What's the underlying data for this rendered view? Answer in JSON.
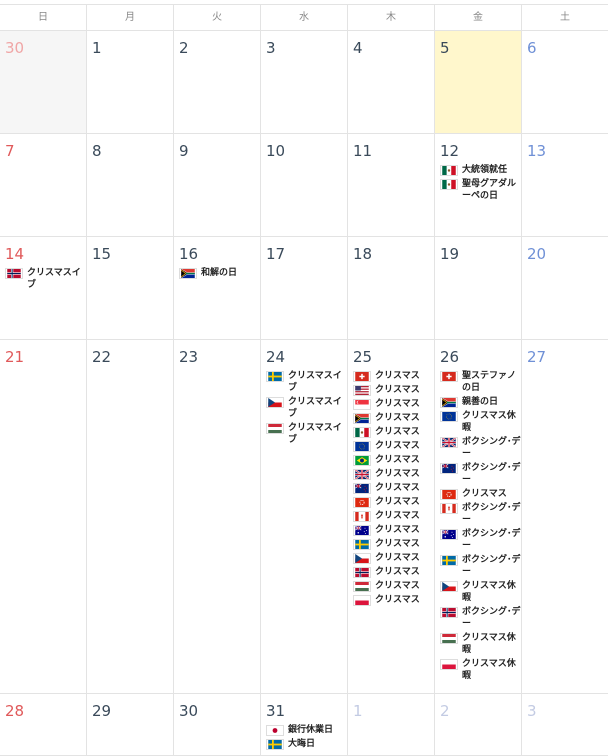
{
  "weekdays": [
    "日",
    "月",
    "火",
    "水",
    "木",
    "金",
    "土"
  ],
  "weeks": [
    {
      "days": [
        {
          "num": "30",
          "kind": "outside-sun",
          "events": []
        },
        {
          "num": "1",
          "kind": "normal",
          "events": []
        },
        {
          "num": "2",
          "kind": "normal",
          "events": []
        },
        {
          "num": "3",
          "kind": "normal",
          "events": []
        },
        {
          "num": "4",
          "kind": "normal",
          "events": []
        },
        {
          "num": "5",
          "kind": "today",
          "events": []
        },
        {
          "num": "6",
          "kind": "sat",
          "events": []
        }
      ]
    },
    {
      "days": [
        {
          "num": "7",
          "kind": "sun",
          "events": []
        },
        {
          "num": "8",
          "kind": "normal",
          "events": []
        },
        {
          "num": "9",
          "kind": "normal",
          "events": []
        },
        {
          "num": "10",
          "kind": "normal",
          "events": []
        },
        {
          "num": "11",
          "kind": "normal",
          "events": []
        },
        {
          "num": "12",
          "kind": "normal",
          "events": [
            {
              "flag": "mexico",
              "label": "大統領就任"
            },
            {
              "flag": "mexico",
              "label": "聖母グアダルーペの日"
            }
          ]
        },
        {
          "num": "13",
          "kind": "sat",
          "events": []
        }
      ]
    },
    {
      "days": [
        {
          "num": "14",
          "kind": "sun",
          "events": [
            {
              "flag": "norway",
              "label": "クリスマスイブ"
            }
          ]
        },
        {
          "num": "15",
          "kind": "normal",
          "events": []
        },
        {
          "num": "16",
          "kind": "normal",
          "events": [
            {
              "flag": "south-africa",
              "label": "和解の日"
            }
          ]
        },
        {
          "num": "17",
          "kind": "normal",
          "events": []
        },
        {
          "num": "18",
          "kind": "normal",
          "events": []
        },
        {
          "num": "19",
          "kind": "normal",
          "events": []
        },
        {
          "num": "20",
          "kind": "sat",
          "events": []
        }
      ]
    },
    {
      "days": [
        {
          "num": "21",
          "kind": "sun",
          "events": []
        },
        {
          "num": "22",
          "kind": "normal",
          "events": []
        },
        {
          "num": "23",
          "kind": "normal",
          "events": []
        },
        {
          "num": "24",
          "kind": "normal",
          "events": [
            {
              "flag": "sweden",
              "label": "クリスマスイブ"
            },
            {
              "flag": "czech",
              "label": "クリスマスイブ"
            },
            {
              "flag": "hungary",
              "label": "クリスマスイブ"
            }
          ]
        },
        {
          "num": "25",
          "kind": "normal",
          "events": [
            {
              "flag": "switzerland",
              "label": "クリスマス"
            },
            {
              "flag": "usa",
              "label": "クリスマス"
            },
            {
              "flag": "singapore",
              "label": "クリスマス"
            },
            {
              "flag": "south-africa",
              "label": "クリスマス"
            },
            {
              "flag": "mexico",
              "label": "クリスマス"
            },
            {
              "flag": "eu",
              "label": "クリスマス"
            },
            {
              "flag": "brazil",
              "label": "クリスマス"
            },
            {
              "flag": "uk",
              "label": "クリスマス"
            },
            {
              "flag": "nz",
              "label": "クリスマス"
            },
            {
              "flag": "hongkong",
              "label": "クリスマス"
            },
            {
              "flag": "canada",
              "label": "クリスマス"
            },
            {
              "flag": "australia",
              "label": "クリスマス"
            },
            {
              "flag": "sweden",
              "label": "クリスマス"
            },
            {
              "flag": "czech",
              "label": "クリスマス"
            },
            {
              "flag": "norway",
              "label": "クリスマス"
            },
            {
              "flag": "hungary",
              "label": "クリスマス"
            },
            {
              "flag": "poland",
              "label": "クリスマス"
            }
          ]
        },
        {
          "num": "26",
          "kind": "normal",
          "events": [
            {
              "flag": "switzerland",
              "label": "聖ステファノの日"
            },
            {
              "flag": "south-africa",
              "label": "親善の日"
            },
            {
              "flag": "eu",
              "label": "クリスマス休暇"
            },
            {
              "flag": "uk",
              "label": "ボクシング･デー"
            },
            {
              "flag": "nz",
              "label": "ボクシング･デー"
            },
            {
              "flag": "hongkong",
              "label": "クリスマス"
            },
            {
              "flag": "canada",
              "label": "ボクシング･デー"
            },
            {
              "flag": "australia",
              "label": "ボクシング･デー"
            },
            {
              "flag": "sweden",
              "label": "ボクシング･デー"
            },
            {
              "flag": "czech",
              "label": "クリスマス休暇"
            },
            {
              "flag": "norway",
              "label": "ボクシング･デー"
            },
            {
              "flag": "hungary",
              "label": "クリスマス休暇"
            },
            {
              "flag": "poland",
              "label": "クリスマス休暇"
            }
          ]
        },
        {
          "num": "27",
          "kind": "sat",
          "events": []
        }
      ]
    },
    {
      "days": [
        {
          "num": "28",
          "kind": "sun",
          "events": []
        },
        {
          "num": "29",
          "kind": "normal",
          "events": []
        },
        {
          "num": "30",
          "kind": "normal",
          "events": []
        },
        {
          "num": "31",
          "kind": "normal",
          "events": [
            {
              "flag": "japan",
              "label": "銀行休業日"
            },
            {
              "flag": "sweden",
              "label": "大晦日"
            }
          ]
        },
        {
          "num": "1",
          "kind": "faded",
          "events": []
        },
        {
          "num": "2",
          "kind": "faded",
          "events": []
        },
        {
          "num": "3",
          "kind": "faded",
          "events": []
        }
      ]
    }
  ],
  "colors": {
    "today_bg": "#fff7cc",
    "sunday": "#e0595a",
    "saturday": "#6f90d6",
    "grid": "#e3e3e3"
  }
}
